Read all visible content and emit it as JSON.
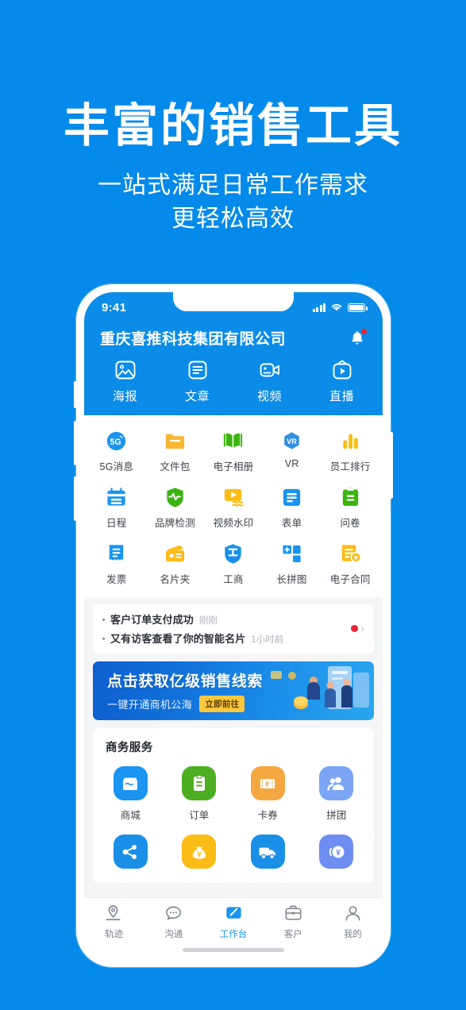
{
  "hero": {
    "title": "丰富的销售工具",
    "subtitle_line1": "一站式满足日常工作需求",
    "subtitle_line2": "更轻松高效"
  },
  "colors": {
    "background": "#038aea",
    "header": "#0a8ce8",
    "accent": "#1a94f0",
    "badge": "#f5222d",
    "banner_button": "#ffc83c"
  },
  "status_bar": {
    "time": "9:41",
    "signal_icon": "signal-bars-icon",
    "wifi_icon": "wifi-icon",
    "battery_icon": "battery-icon"
  },
  "header": {
    "company": "重庆喜推科技集团有限公司",
    "bell_icon": "bell-icon",
    "has_badge": true
  },
  "top_tabs": [
    {
      "label": "海报",
      "icon": "image-icon"
    },
    {
      "label": "文章",
      "icon": "article-icon"
    },
    {
      "label": "视频",
      "icon": "video-camera-icon"
    },
    {
      "label": "直播",
      "icon": "live-tv-icon"
    }
  ],
  "tools_grid": [
    [
      {
        "label": "5G消息",
        "icon": "5g-message-icon",
        "color": "#1a94f0"
      },
      {
        "label": "文件包",
        "icon": "folder-icon",
        "color": "#f7b733"
      },
      {
        "label": "电子相册",
        "icon": "book-icon",
        "color": "#3cb410"
      },
      {
        "label": "VR",
        "icon": "vr-icon",
        "color": "#1a94f0"
      },
      {
        "label": "员工排行",
        "icon": "bar-chart-icon",
        "color": "#f7b733"
      }
    ],
    [
      {
        "label": "日程",
        "icon": "calendar-icon",
        "color": "#1a94f0"
      },
      {
        "label": "品牌检测",
        "icon": "shield-pulse-icon",
        "color": "#3cb410"
      },
      {
        "label": "视频水印",
        "icon": "video-watermark-icon",
        "color": "#f7b733"
      },
      {
        "label": "表单",
        "icon": "form-icon",
        "color": "#1a94f0"
      },
      {
        "label": "问卷",
        "icon": "clipboard-icon",
        "color": "#3cb410"
      }
    ],
    [
      {
        "label": "发票",
        "icon": "invoice-icon",
        "color": "#1a94f0"
      },
      {
        "label": "名片夹",
        "icon": "card-holder-icon",
        "color": "#f7b733"
      },
      {
        "label": "工商",
        "icon": "business-shield-icon",
        "color": "#1a94f0"
      },
      {
        "label": "长拼图",
        "icon": "collage-icon",
        "color": "#1a94f0"
      },
      {
        "label": "电子合同",
        "icon": "contract-star-icon",
        "color": "#f7b733"
      }
    ]
  ],
  "notices": [
    {
      "text": "客户订单支付成功",
      "time": "刚刚"
    },
    {
      "text": "又有访客查看了你的智能名片",
      "time": "1小时前"
    }
  ],
  "notice_indicator": {
    "dot_color": "#ee2233",
    "chevron_icon": "chevron-right-icon"
  },
  "banner": {
    "title": "点击获取亿级销售线索",
    "subtitle": "一键开通商机公海",
    "button": "立即前往"
  },
  "services": {
    "title": "商务服务",
    "row1": [
      {
        "label": "商城",
        "icon": "shop-icon",
        "color": "#1a94f0"
      },
      {
        "label": "订单",
        "icon": "order-clipboard-icon",
        "color": "#4cae21"
      },
      {
        "label": "卡券",
        "icon": "coupon-icon",
        "color": "#f5a742"
      },
      {
        "label": "拼团",
        "icon": "group-buy-icon",
        "color": "#7aa6f5"
      }
    ],
    "row2": [
      {
        "label": "",
        "icon": "share-icon",
        "color": "#1a8fe8"
      },
      {
        "label": "",
        "icon": "money-bag-icon",
        "color": "#fbbc16"
      },
      {
        "label": "",
        "icon": "delivery-truck-icon",
        "color": "#1a8fe8"
      },
      {
        "label": "",
        "icon": "yuan-coin-icon",
        "color": "#6d8ef0"
      }
    ]
  },
  "bottom_nav": [
    {
      "label": "轨迹",
      "icon": "location-track-icon",
      "active": false
    },
    {
      "label": "沟通",
      "icon": "chat-bubble-icon",
      "active": false
    },
    {
      "label": "工作台",
      "icon": "workbench-icon",
      "active": true
    },
    {
      "label": "客户",
      "icon": "briefcase-icon",
      "active": false
    },
    {
      "label": "我的",
      "icon": "user-icon",
      "active": false
    }
  ]
}
